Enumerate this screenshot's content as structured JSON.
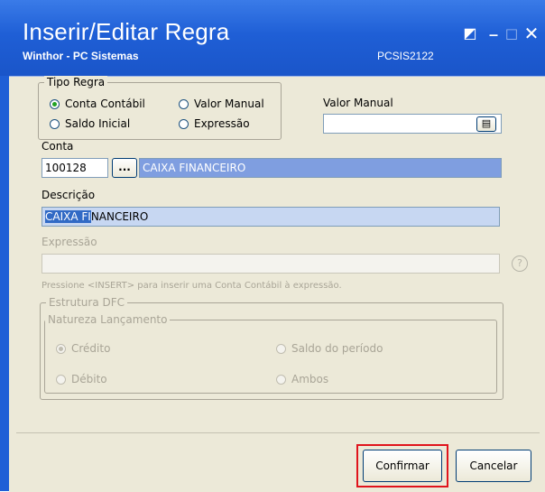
{
  "window": {
    "title": "Inserir/Editar Regra",
    "subtitle": "Winthor - PC Sistemas",
    "code": "PCSIS2122",
    "controls": {
      "restore": "◩",
      "minimize": "_",
      "maximize": "□",
      "close": "✕"
    }
  },
  "tipo_regra": {
    "legend": "Tipo Regra",
    "options": [
      {
        "label": "Conta Contábil",
        "checked": true
      },
      {
        "label": "Valor Manual",
        "checked": false
      },
      {
        "label": "Saldo Inicial",
        "checked": false
      },
      {
        "label": "Expressão",
        "checked": false
      }
    ]
  },
  "valor_manual": {
    "label": "Valor Manual",
    "value": ""
  },
  "conta": {
    "label": "Conta",
    "code": "100128",
    "lookup_label": "...",
    "name": "CAIXA FINANCEIRO"
  },
  "descricao": {
    "label": "Descrição",
    "value_selected": "CAIXA FI",
    "value_rest": "NANCEIRO"
  },
  "expressao": {
    "label": "Expressão",
    "value": "",
    "hint": "Pressione <INSERT> para inserir uma Conta Contábil à expressão.",
    "help": "?"
  },
  "estrutura_dfc": {
    "legend": "Estrutura DFC",
    "natureza": {
      "legend": "Natureza Lançamento",
      "options": [
        {
          "label": "Crédito",
          "checked": true
        },
        {
          "label": "Saldo do período",
          "checked": false
        },
        {
          "label": "Débito",
          "checked": false
        },
        {
          "label": "Ambos",
          "checked": false
        }
      ]
    }
  },
  "buttons": {
    "confirm": "Confirmar",
    "cancel": "Cancelar"
  },
  "colors": {
    "title_bar": "#1f5fd6",
    "highlight": "#e0141c",
    "readonly_field": "#7f9ee0"
  }
}
